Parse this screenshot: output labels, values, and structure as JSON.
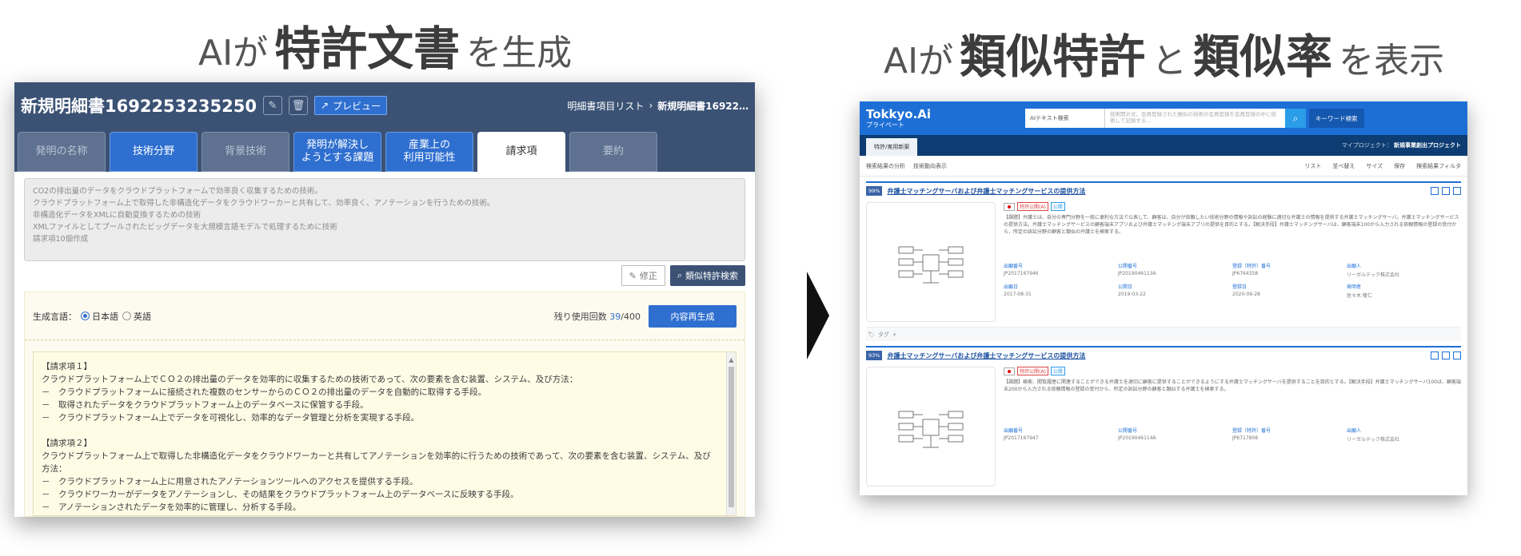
{
  "headline_left": {
    "pre": "AIが",
    "bold": "特許文書",
    "post": "を生成"
  },
  "headline_right": {
    "pre": "AIが",
    "bold1": "類似特許",
    "mid": "と",
    "bold2": "類似率",
    "post": "を表示"
  },
  "left": {
    "title": "新規明細書1692253235250",
    "preview_label": "プレビュー",
    "breadcrumb": {
      "list": "明細書項目リスト",
      "sep": "›",
      "current": "新規明細書16922…"
    },
    "tabs": [
      {
        "label": "発明の名称",
        "state": "gray"
      },
      {
        "label": "技術分野",
        "state": "blue"
      },
      {
        "label": "背景技術",
        "state": "gray"
      },
      {
        "label": "発明が解決し\nようとする課題",
        "state": "blue"
      },
      {
        "label": "産業上の\n利用可能性",
        "state": "blue"
      },
      {
        "label": "請求項",
        "state": "white"
      },
      {
        "label": "要約",
        "state": "gray"
      }
    ],
    "summary_lines": [
      "CO2の排出量のデータをクラウドプラットフォームで効率良く収集するための技術。",
      "クラウドプラットフォーム上で取得した非構造化データをクラウドワーカーと共有して、効率良く、アノテーションを行うための技術。",
      "非構造化データをXMLに自動変換するための技術",
      "XMLファイルとしてプールされたビッグデータを大規模言語モデルで処理するために技術",
      "請求項10個作成"
    ],
    "edit_label": "修正",
    "similar_search_label": "類似特許検索",
    "gen_language_label": "生成言語：",
    "lang_ja": "日本語",
    "lang_en": "英語",
    "remaining_label": "残り使用回数",
    "remaining_used": "39",
    "remaining_total": "/400",
    "regen_label": "内容再生成",
    "claims": [
      "【請求項１】",
      "クラウドプラットフォーム上でＣＯ２の排出量のデータを効率的に収集するための技術であって、次の要素を含む装置、システム、及び方法：",
      "－　クラウドプラットフォームに接続された複数のセンサーからのＣＯ２の排出量のデータを自動的に取得する手段。",
      "－　取得されたデータをクラウドプラットフォーム上のデータベースに保管する手段。",
      "－　クラウドプラットフォーム上でデータを可視化し、効率的なデータ管理と分析を実現する手段。",
      "",
      "【請求項２】",
      "クラウドプラットフォーム上で取得した非構造化データをクラウドワーカーと共有してアノテーションを効率的に行うための技術であって、次の要素を含む装置、システム、及び方法：",
      "－　クラウドプラットフォーム上に用意されたアノテーションツールへのアクセスを提供する手段。",
      "－　クラウドワーカーがデータをアノテーションし、その結果をクラウドプラットフォーム上のデータベースに反映する手段。",
      "－　アノテーションされたデータを効率的に管理し、分析する手段。"
    ]
  },
  "right": {
    "logo": "Tokkyo.Ai",
    "logo_sub": "プライベート",
    "search_mode": "AIテキスト検索",
    "search_placeholder": "技術開示文、会員登録された類似の技術の会員登録を会員登録の中に技術して記録する...",
    "keyword_btn": "キーワード検索",
    "tab_label": "特許/実用新案",
    "project_label": "マイプロジェクト：",
    "project_name": "新規事業創出プロジェクト",
    "toolbar_left": [
      "検索結果の分析",
      "技術動向表示"
    ],
    "toolbar_right": [
      "リスト",
      "並べ替え",
      "サイズ",
      "保存",
      "検索結果フィルタ"
    ],
    "cards": [
      {
        "pct": "99%",
        "title": "弁護士マッチングサーバおよび弁護士マッチングサービスの提供方法",
        "badge1": "特許公開(A)",
        "badge2": "公開",
        "abstract": "【課題】弁護士は、自分の専門分野を一般に便利な方法で公表して、顧客は、自分が依頼したい技術分野の情報や訴訟の経験に適切な弁護士の情報を提供する弁護士マッチングサーバ。弁護士マッチングサービスの提供方法。弁護士マッチングサービスの顧客端末アプリおよび弁護士マッチング端末アプリの提供を目的とする。【解決手段】弁護士マッチングサーバは、顧客端末100から入力される依頼情報の登録の受付から、所定の訴訟分野の顧客と類似の弁護士を検索する。",
        "meta": [
          {
            "k": "出願番号",
            "v": "JP2017167946"
          },
          {
            "k": "公開番号",
            "v": "JP2019046113A"
          },
          {
            "k": "登録（特許）番号",
            "v": "JP6764358"
          },
          {
            "k": "出願人",
            "v": "リーガルテック株式会社"
          },
          {
            "k": "出願日",
            "v": "2017-08-31"
          },
          {
            "k": "公開日",
            "v": "2019-03-22"
          },
          {
            "k": "登録日",
            "v": "2020-09-28"
          },
          {
            "k": "発明者",
            "v": "佐々木 隆仁"
          }
        ]
      },
      {
        "pct": "93%",
        "title": "弁護士マッチングサーバおよび弁護士マッチングサービスの提供方法",
        "badge1": "特許公開(A)",
        "badge2": "公開",
        "abstract": "【課題】検索、閲覧履歴に関連することができる弁護士を適切に顧客に提供することができるようにする弁護士マッチングサーバを提供することを目的とする。【解決手段】弁護士マッチングサーバ100は、顧客端末200から入力される依頼情報の登録の受付から、所定の訴訟分野の顧客と類似する弁護士を検索する。",
        "meta": [
          {
            "k": "出願番号",
            "v": "JP2017167947"
          },
          {
            "k": "公開番号",
            "v": "JP2019046114A"
          },
          {
            "k": "登録（特許）番号",
            "v": "JP6717808"
          },
          {
            "k": "出願人",
            "v": "リーガルテック株式会社"
          }
        ]
      }
    ],
    "tag_label": "タグ"
  }
}
